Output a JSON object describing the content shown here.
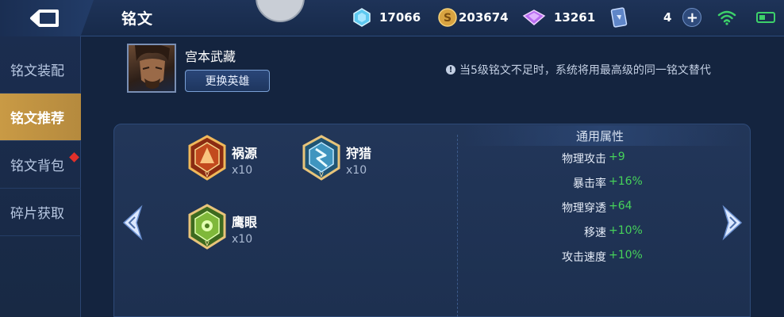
{
  "topbar": {
    "title": "铭文",
    "resources": [
      {
        "icon": "diamond-gem-icon",
        "value": "17066"
      },
      {
        "icon": "gold-coin-icon",
        "value": "203674"
      },
      {
        "icon": "purple-crystal-icon",
        "value": "13261"
      },
      {
        "icon": "card-ticket-icon",
        "value": "4"
      }
    ]
  },
  "sidebar": {
    "items": [
      {
        "label": "铭文装配",
        "active": false
      },
      {
        "label": "铭文推荐",
        "active": true
      },
      {
        "label": "铭文背包",
        "active": false
      },
      {
        "label": "碎片获取",
        "active": false
      }
    ]
  },
  "hero": {
    "name": "宫本武藏",
    "switch_label": "更换英雄"
  },
  "notice": "当5级铭文不足时，系统将用最高级的同一铭文替代",
  "runes": [
    {
      "name": "祸源",
      "count": "x10",
      "color": "red",
      "roman": "V"
    },
    {
      "name": "狩猎",
      "count": "x10",
      "color": "blue",
      "roman": "V"
    },
    {
      "name": "鹰眼",
      "count": "x10",
      "color": "green",
      "roman": "V"
    }
  ],
  "stats": {
    "title": "通用属性",
    "rows": [
      {
        "name": "物理攻击",
        "value": "+9"
      },
      {
        "name": "暴击率",
        "value": "+16%"
      },
      {
        "name": "物理穿透",
        "value": "+64"
      },
      {
        "name": "移速",
        "value": "+10%"
      },
      {
        "name": "攻击速度",
        "value": "+10%"
      }
    ]
  },
  "colors": {
    "accent_gold": "#c99a45",
    "stat_green": "#46d25a",
    "bg": "#14243f"
  }
}
